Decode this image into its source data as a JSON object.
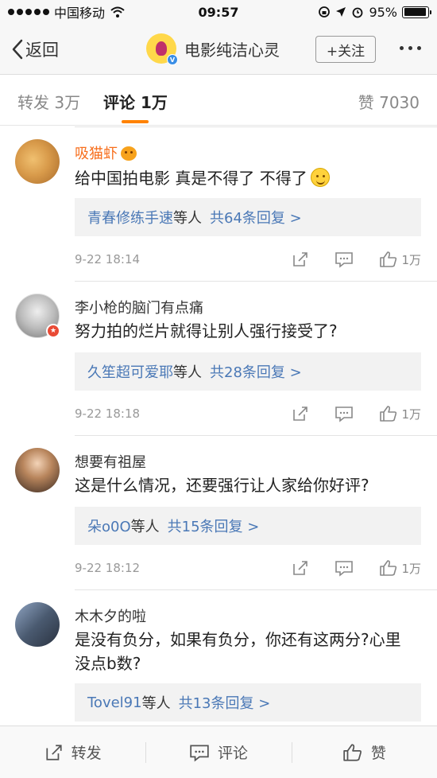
{
  "status_bar": {
    "carrier": "中国移动",
    "time": "09:57",
    "battery_percent": "95%",
    "battery_level": 0.95
  },
  "nav": {
    "back_label": "返回",
    "title": "电影纯洁心灵",
    "follow_label": "+关注"
  },
  "tabs": {
    "repost": "转发 3万",
    "comment": "评论 1万",
    "likes": "赞 7030"
  },
  "comments": [
    {
      "username": "吸猫虾",
      "text": "给中国拍电影  真是不得了 不得了",
      "reply_users": "青春修练手速",
      "reply_suffix": "等人",
      "reply_count": "共64条回复 >",
      "time": "9-22 18:14",
      "likes": "1万"
    },
    {
      "username": "李小枪的脑门有点痛",
      "text": "努力拍的烂片就得让别人强行接受了?",
      "reply_users": "久笙超可爱耶",
      "reply_suffix": "等人",
      "reply_count": "共28条回复 >",
      "time": "9-22 18:18",
      "likes": "1万"
    },
    {
      "username": "想要有祖屋",
      "text": "这是什么情况，还要强行让人家给你好评?",
      "reply_users": "朵o0O",
      "reply_suffix": "等人",
      "reply_count": "共15条回复 >",
      "time": "9-22 18:12",
      "likes": "1万"
    },
    {
      "username": "木木夕的啦",
      "text": "是没有负分，如果有负分，你还有这两分?心里没点b数?",
      "reply_users": "Tovel91",
      "reply_suffix": "等人",
      "reply_count": "共13条回复 >"
    }
  ],
  "bottom_bar": {
    "repost": "转发",
    "comment": "评论",
    "like": "赞"
  },
  "colors": {
    "accent": "#ff8200",
    "link": "#4a78b6",
    "vip_name": "#f76e1c"
  },
  "icons": [
    "back-chevron-icon",
    "wifi-icon",
    "lock-rotation-icon",
    "location-arrow-icon",
    "alarm-icon",
    "battery-icon",
    "more-dots-icon",
    "repost-icon",
    "comment-icon",
    "like-thumb-icon",
    "verified-icon",
    "vip-emoji-icon",
    "smile-emoji-icon"
  ]
}
